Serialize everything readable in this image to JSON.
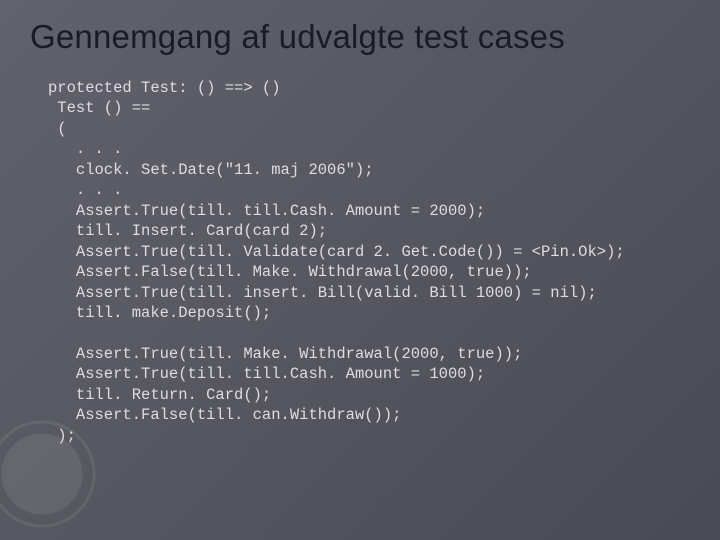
{
  "slide": {
    "title": "Gennemgang af udvalgte test cases",
    "code": "protected Test: () ==> ()\n Test () ==\n (\n   . . .\n   clock. Set.Date(\"11. maj 2006\");\n   . . .\n   Assert.True(till. till.Cash. Amount = 2000);\n   till. Insert. Card(card 2);\n   Assert.True(till. Validate(card 2. Get.Code()) = <Pin.Ok>);\n   Assert.False(till. Make. Withdrawal(2000, true));\n   Assert.True(till. insert. Bill(valid. Bill 1000) = nil);\n   till. make.Deposit();\n\n   Assert.True(till. Make. Withdrawal(2000, true));\n   Assert.True(till. till.Cash. Amount = 1000);\n   till. Return. Card();\n   Assert.False(till. can.Withdraw());\n );"
  }
}
